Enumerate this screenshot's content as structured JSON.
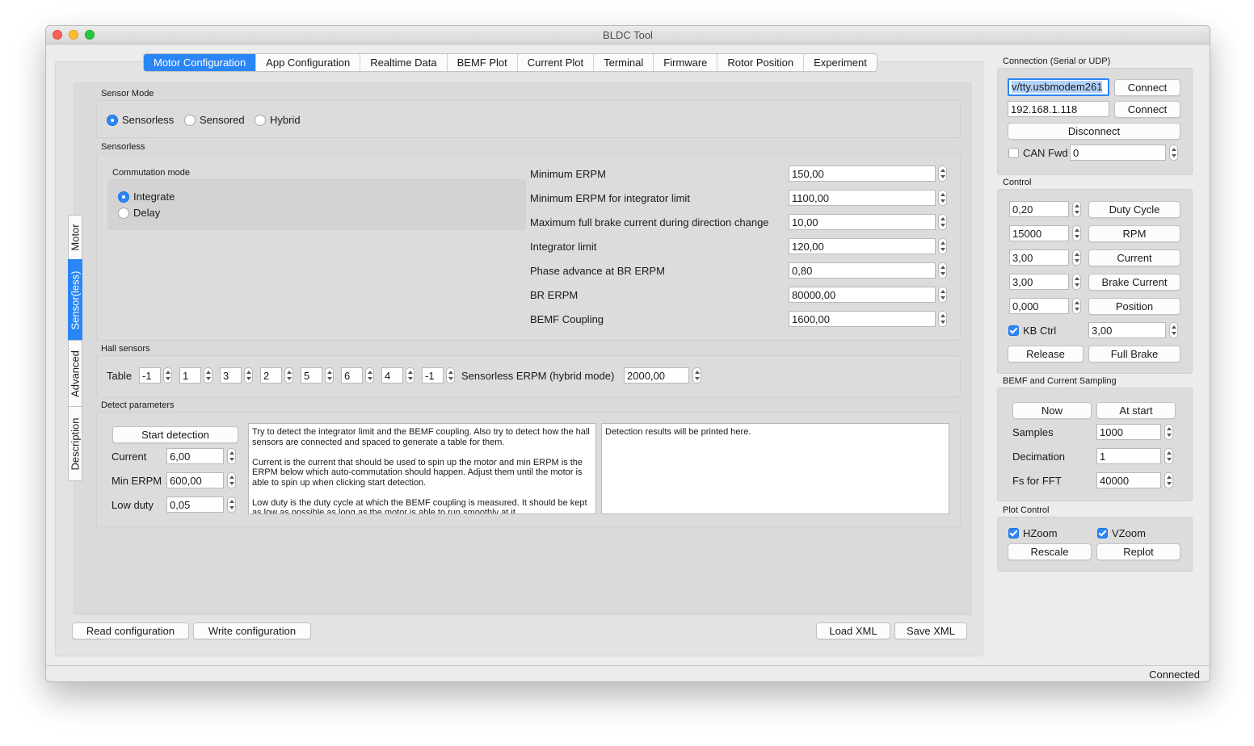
{
  "window": {
    "title": "BLDC Tool"
  },
  "tabs": [
    "Motor Configuration",
    "App Configuration",
    "Realtime Data",
    "BEMF Plot",
    "Current Plot",
    "Terminal",
    "Firmware",
    "Rotor Position",
    "Experiment"
  ],
  "side_tabs": [
    "Motor",
    "Sensor(less)",
    "Advanced",
    "Description"
  ],
  "sensor_mode": {
    "label": "Sensor Mode",
    "options": [
      "Sensorless",
      "Sensored",
      "Hybrid"
    ],
    "selected": "Sensorless"
  },
  "sensorless": {
    "label": "Sensorless",
    "commutation": {
      "label": "Commutation mode",
      "options": [
        "Integrate",
        "Delay"
      ],
      "selected": "Integrate"
    },
    "params": [
      {
        "label": "Minimum ERPM",
        "value": "150,00"
      },
      {
        "label": "Minimum ERPM for integrator limit",
        "value": "1100,00"
      },
      {
        "label": "Maximum full brake current during direction change",
        "value": "10,00"
      },
      {
        "label": "Integrator limit",
        "value": "120,00"
      },
      {
        "label": "Phase advance at BR ERPM",
        "value": "0,80"
      },
      {
        "label": "BR ERPM",
        "value": "80000,00"
      },
      {
        "label": "BEMF Coupling",
        "value": "1600,00"
      }
    ]
  },
  "hall": {
    "label": "Hall sensors",
    "table_label": "Table",
    "table": [
      "-1",
      "1",
      "3",
      "2",
      "5",
      "6",
      "4",
      "-1"
    ],
    "hybrid_label": "Sensorless ERPM (hybrid mode)",
    "hybrid_value": "2000,00"
  },
  "detect": {
    "label": "Detect parameters",
    "start_button": "Start detection",
    "fields": [
      {
        "label": "Current",
        "value": "6,00"
      },
      {
        "label": "Min ERPM",
        "value": "600,00"
      },
      {
        "label": "Low duty",
        "value": "0,05"
      }
    ],
    "help_text": "Try to detect the integrator limit and the BEMF coupling. Also try to detect how the hall sensors are connected and spaced to generate a table for them.\n\nCurrent is the current that should be used to spin up the motor and min ERPM is the ERPM below which auto-commutation should happen. Adjust them until the motor is able to spin up when clicking start detection.\n\nLow duty is the duty cycle at which the BEMF coupling is measured. It should be kept as low as possible as long as the motor is able to run smoothly at it.",
    "results_text": "Detection results will be printed here."
  },
  "bottom_buttons": {
    "read": "Read configuration",
    "write": "Write configuration",
    "load": "Load XML",
    "save": "Save XML"
  },
  "connection": {
    "label": "Connection (Serial or UDP)",
    "serial_port": "v/tty.usbmodem261",
    "udp_address": "192.168.1.118",
    "connect": "Connect",
    "disconnect": "Disconnect",
    "can_fwd_label": "CAN Fwd",
    "can_fwd_checked": false,
    "can_fwd_value": "0"
  },
  "control": {
    "label": "Control",
    "rows": [
      {
        "value": "0,20",
        "button": "Duty Cycle"
      },
      {
        "value": "15000",
        "button": "RPM"
      },
      {
        "value": "3,00",
        "button": "Current"
      },
      {
        "value": "3,00",
        "button": "Brake Current"
      },
      {
        "value": "0,000",
        "button": "Position"
      }
    ],
    "kb_ctrl_label": "KB Ctrl",
    "kb_ctrl_checked": true,
    "kb_ctrl_value": "3,00",
    "release": "Release",
    "full_brake": "Full Brake"
  },
  "bemf_sampling": {
    "label": "BEMF and Current Sampling",
    "now": "Now",
    "at_start": "At start",
    "fields": [
      {
        "label": "Samples",
        "value": "1000"
      },
      {
        "label": "Decimation",
        "value": "1"
      },
      {
        "label": "Fs for FFT",
        "value": "40000"
      }
    ]
  },
  "plot_control": {
    "label": "Plot Control",
    "hzoom": "HZoom",
    "hzoom_checked": true,
    "vzoom": "VZoom",
    "vzoom_checked": true,
    "rescale": "Rescale",
    "replot": "Replot"
  },
  "status": {
    "text": "Connected"
  },
  "colors": {
    "accent": "#2a85f6",
    "window_bg": "#ececec",
    "close": "#fc5f57",
    "minimize": "#fdbc2e",
    "zoom": "#28c840"
  }
}
